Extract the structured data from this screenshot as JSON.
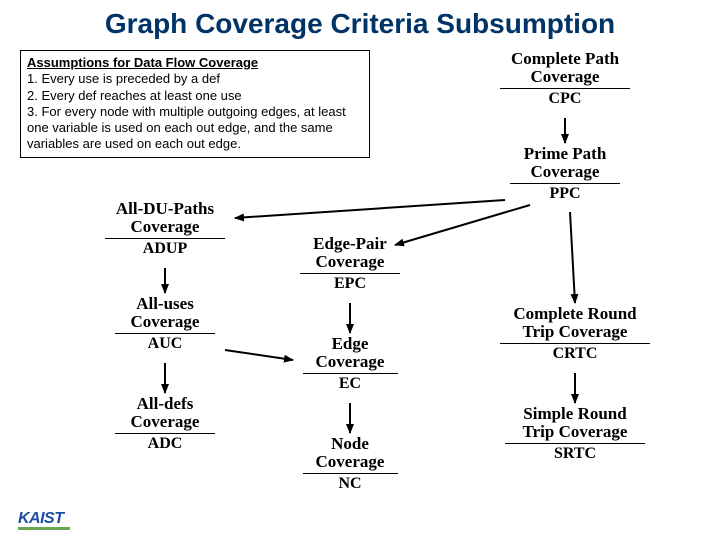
{
  "title": "Graph Coverage Criteria Subsumption",
  "assumptions": {
    "heading": "Assumptions for Data Flow Coverage",
    "items": [
      "1. Every use is preceded by a def",
      "2. Every def reaches at least one use",
      "3. For every node with multiple outgoing edges, at least one variable is used on each out edge, and the same variables are used on each out edge."
    ]
  },
  "nodes": {
    "cpc": {
      "name_l1": "Complete Path",
      "name_l2": "Coverage",
      "abbr": "CPC"
    },
    "ppc": {
      "name_l1": "Prime Path",
      "name_l2": "Coverage",
      "abbr": "PPC"
    },
    "adup": {
      "name_l1": "All-DU-Paths",
      "name_l2": "Coverage",
      "abbr": "ADUP"
    },
    "epc": {
      "name_l1": "Edge-Pair",
      "name_l2": "Coverage",
      "abbr": "EPC"
    },
    "auc": {
      "name_l1": "All-uses",
      "name_l2": "Coverage",
      "abbr": "AUC"
    },
    "ec": {
      "name_l1": "Edge",
      "name_l2": "Coverage",
      "abbr": "EC"
    },
    "crtc": {
      "name_l1": "Complete Round",
      "name_l2": "Trip Coverage",
      "abbr": "CRTC"
    },
    "adc": {
      "name_l1": "All-defs",
      "name_l2": "Coverage",
      "abbr": "ADC"
    },
    "nc": {
      "name_l1": "Node",
      "name_l2": "Coverage",
      "abbr": "NC"
    },
    "srtc": {
      "name_l1": "Simple Round",
      "name_l2": "Trip Coverage",
      "abbr": "SRTC"
    }
  },
  "logo": "KAIST"
}
